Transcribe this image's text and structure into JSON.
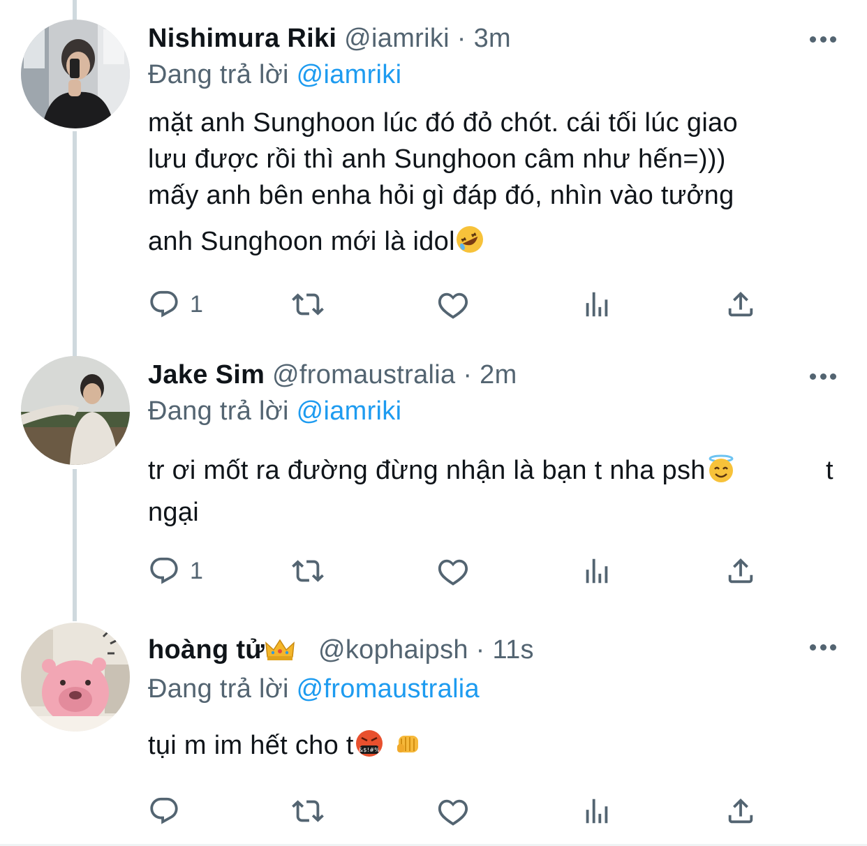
{
  "tweets": [
    {
      "name": "Nishimura Riki",
      "handle": "@iamriki",
      "separator": "·",
      "time": "3m",
      "reply_prefix": "Đang trả lời",
      "reply_to": "@iamriki",
      "lines": [
        "mặt anh Sunghoon lúc đó đỏ chót. cái tối lúc giao",
        "lưu được rồi thì anh Sunghoon câm như hến=)))",
        "mấy anh bên enha hỏi gì đáp đó, nhìn vào tưởng",
        "anh Sunghoon mới là idol"
      ],
      "reply_count": "1",
      "avatar_icon": "person-mirror-selfie"
    },
    {
      "name": "Jake Sim",
      "handle": "@fromaustralia",
      "separator": "·",
      "time": "2m",
      "reply_prefix": "Đang trả lời",
      "reply_to": "@iamriki",
      "lines": [
        "tr ơi mốt ra đường đừng nhận là bạn t nha psh",
        "t",
        "ngại"
      ],
      "reply_count": "1",
      "avatar_icon": "person-outdoor"
    },
    {
      "name": "hoàng tử",
      "handle": "@kophaipsh",
      "separator": "·",
      "time": "11s",
      "reply_prefix": "Đang trả lời",
      "reply_to": "@fromaustralia",
      "lines": [
        "tụi m im hết cho t"
      ],
      "reply_count": "",
      "avatar_icon": "pink-beaver-cartoon"
    }
  ],
  "icons": {
    "reply": "reply-icon",
    "retweet": "retweet-icon",
    "like": "heart-icon",
    "views": "analytics-icon",
    "share": "share-icon",
    "more": "more-icon"
  },
  "colors": {
    "link": "#1d9bf0",
    "muted": "#536471",
    "text": "#0f1419",
    "thread_line": "#cfd9de"
  }
}
